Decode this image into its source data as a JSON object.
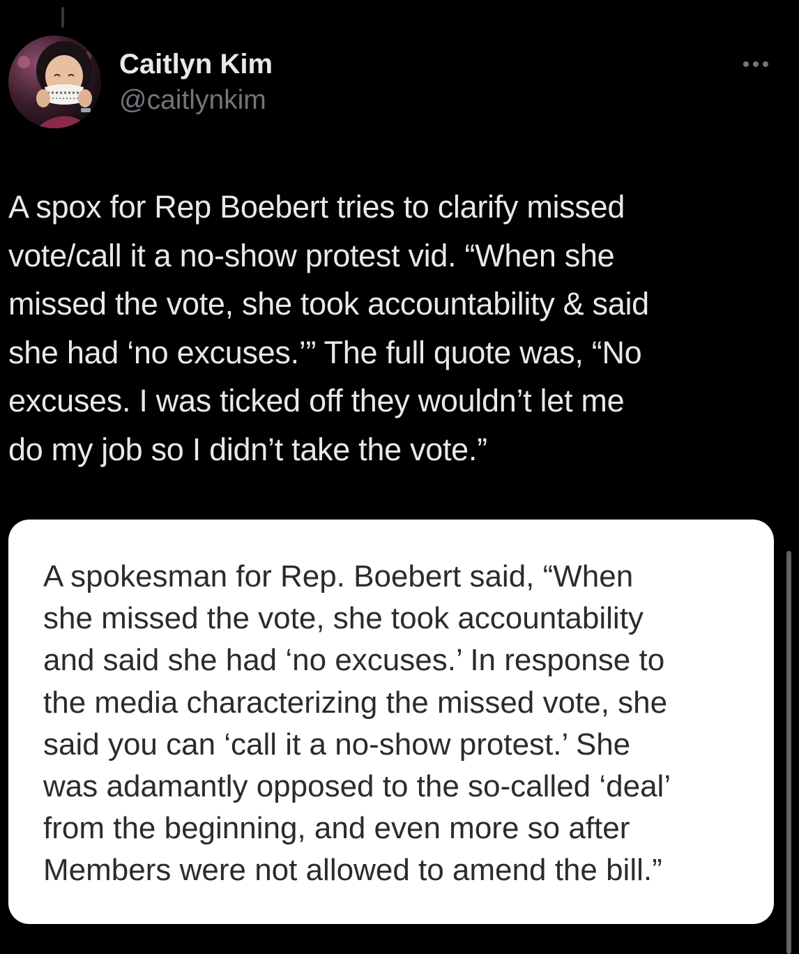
{
  "tweet": {
    "author": {
      "display_name": "Caitlyn Kim",
      "handle": "@caitlynkim",
      "avatar_icon": "profile-photo"
    },
    "more_icon": "more-options-icon",
    "text": "A spox for Rep Boebert tries to clarify missed\nvote/call it a no-show protest vid. “When she\nmissed the vote, she took accountability & said\nshe had ‘no excuses.’”  The full quote was, “No\nexcuses. I was ticked off they wouldn’t let me\ndo my job so I didn’t take the vote.”",
    "quote_image": {
      "text": "A spokesman for Rep. Boebert said, “When\nshe missed the vote, she took accountability\nand said she had ‘no excuses.’ In response to\nthe media characterizing the missed vote, she\nsaid you can ‘call it a no-show protest.’ She\nwas adamantly opposed to the so-called ‘deal’\nfrom the beginning, and even more so after\nMembers were not allowed to amend the bill.”"
    }
  },
  "colors": {
    "background": "#000000",
    "primary_text": "#e7e9ea",
    "secondary_text": "#71767b",
    "card_background": "#ffffff",
    "card_text": "#2b2b2b"
  }
}
